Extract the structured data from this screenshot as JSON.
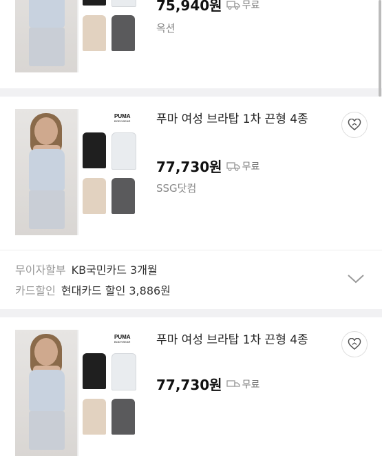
{
  "products": [
    {
      "title": "",
      "price": "75,940원",
      "shipping": "무료",
      "seller": "옥션"
    },
    {
      "title": "푸마 여성 브라탑 1차 끈형 4종",
      "price": "77,730원",
      "shipping": "무료",
      "seller": "SSG닷컴",
      "brand_logo": "PUMA",
      "brand_sub": "BODYWEAR"
    },
    {
      "title": "푸마 여성 브라탑 1차 끈형 4종",
      "price": "77,730원",
      "shipping": "무료",
      "brand_logo": "PUMA",
      "brand_sub": "BODYWEAR"
    }
  ],
  "benefits": [
    {
      "label": "무이자할부",
      "value": "KB국민카드 3개월"
    },
    {
      "label": "카드할인",
      "value": "현대카드 할인 3,886원"
    }
  ],
  "icons": {
    "wishlist": "heart-plus-icon",
    "shipping": "truck-icon",
    "expand": "chevron-down-icon"
  },
  "colors": {
    "background": "#ffffff",
    "separator": "#f1f1f3",
    "muted": "#888888"
  }
}
